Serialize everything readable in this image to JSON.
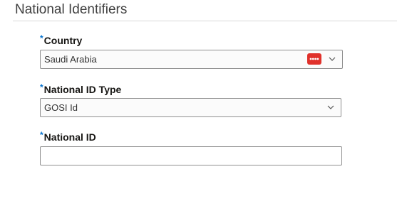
{
  "section": {
    "title": "National Identifiers"
  },
  "fields": {
    "country": {
      "required_mark": "*",
      "label": "Country",
      "value": "Saudi Arabia"
    },
    "national_id_type": {
      "required_mark": "*",
      "label": "National ID Type",
      "value": "GOSI Id"
    },
    "national_id": {
      "required_mark": "*",
      "label": "National ID",
      "value": ""
    }
  },
  "icons": {
    "badge_icon": "password-manager-icon",
    "dropdown_icon": "chevron-down-icon"
  },
  "colors": {
    "required_mark": "#0572ce",
    "badge": "#e0312b",
    "border": "#8f8f8f"
  }
}
